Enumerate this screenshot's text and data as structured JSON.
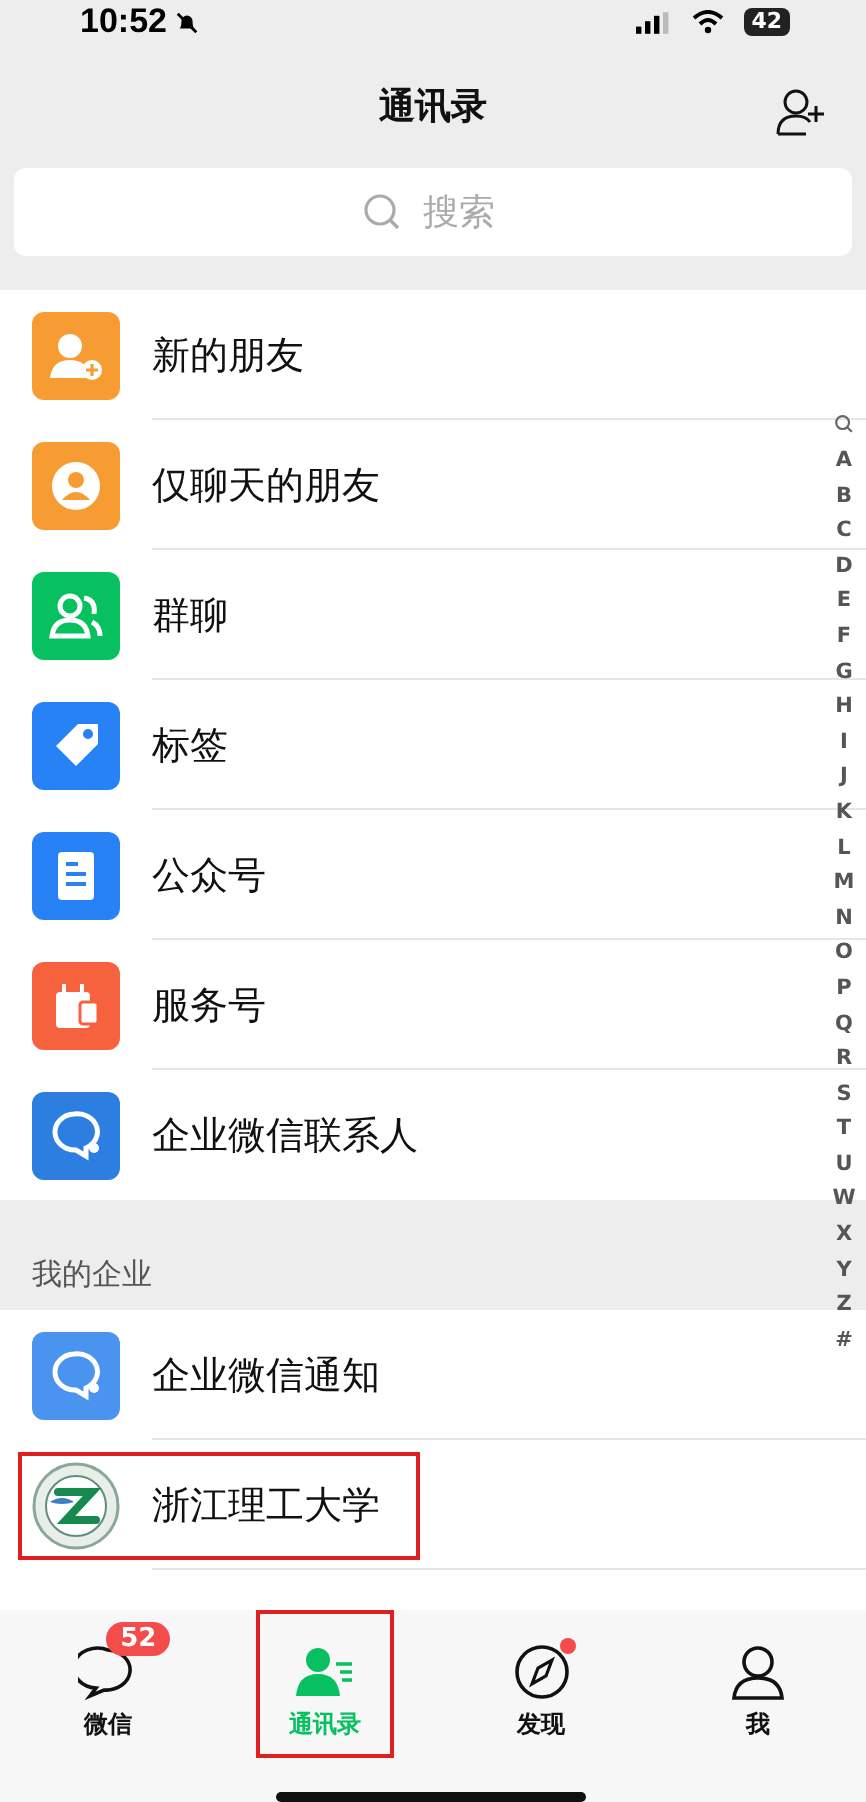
{
  "status_bar": {
    "time": "10:52",
    "battery": "42"
  },
  "header": {
    "title": "通讯录"
  },
  "search": {
    "placeholder": "搜索"
  },
  "entries": [
    {
      "label": "新的朋友",
      "kind": "new-friends"
    },
    {
      "label": "仅聊天的朋友",
      "kind": "chat-only"
    },
    {
      "label": "群聊",
      "kind": "group"
    },
    {
      "label": "标签",
      "kind": "tag"
    },
    {
      "label": "公众号",
      "kind": "official"
    },
    {
      "label": "服务号",
      "kind": "service"
    },
    {
      "label": "企业微信联系人",
      "kind": "wecom"
    }
  ],
  "section": {
    "title": "我的企业",
    "items": [
      {
        "label": "企业微信通知",
        "kind": "wecom-light",
        "highlighted": false
      },
      {
        "label": "浙江理工大学",
        "kind": "logo",
        "highlighted": true
      }
    ]
  },
  "index": [
    "A",
    "B",
    "C",
    "D",
    "E",
    "F",
    "G",
    "H",
    "I",
    "J",
    "K",
    "L",
    "M",
    "N",
    "O",
    "P",
    "Q",
    "R",
    "S",
    "T",
    "U",
    "W",
    "X",
    "Y",
    "Z",
    "#"
  ],
  "tabs": [
    {
      "label": "微信",
      "kind": "chats",
      "selected": false,
      "badge": "52",
      "dot": false,
      "highlighted": false
    },
    {
      "label": "通讯录",
      "kind": "contacts",
      "selected": true,
      "dot": false,
      "highlighted": true
    },
    {
      "label": "发现",
      "kind": "discover",
      "selected": false,
      "dot": true,
      "highlighted": false
    },
    {
      "label": "我",
      "kind": "me",
      "selected": false,
      "dot": false,
      "highlighted": false
    }
  ]
}
